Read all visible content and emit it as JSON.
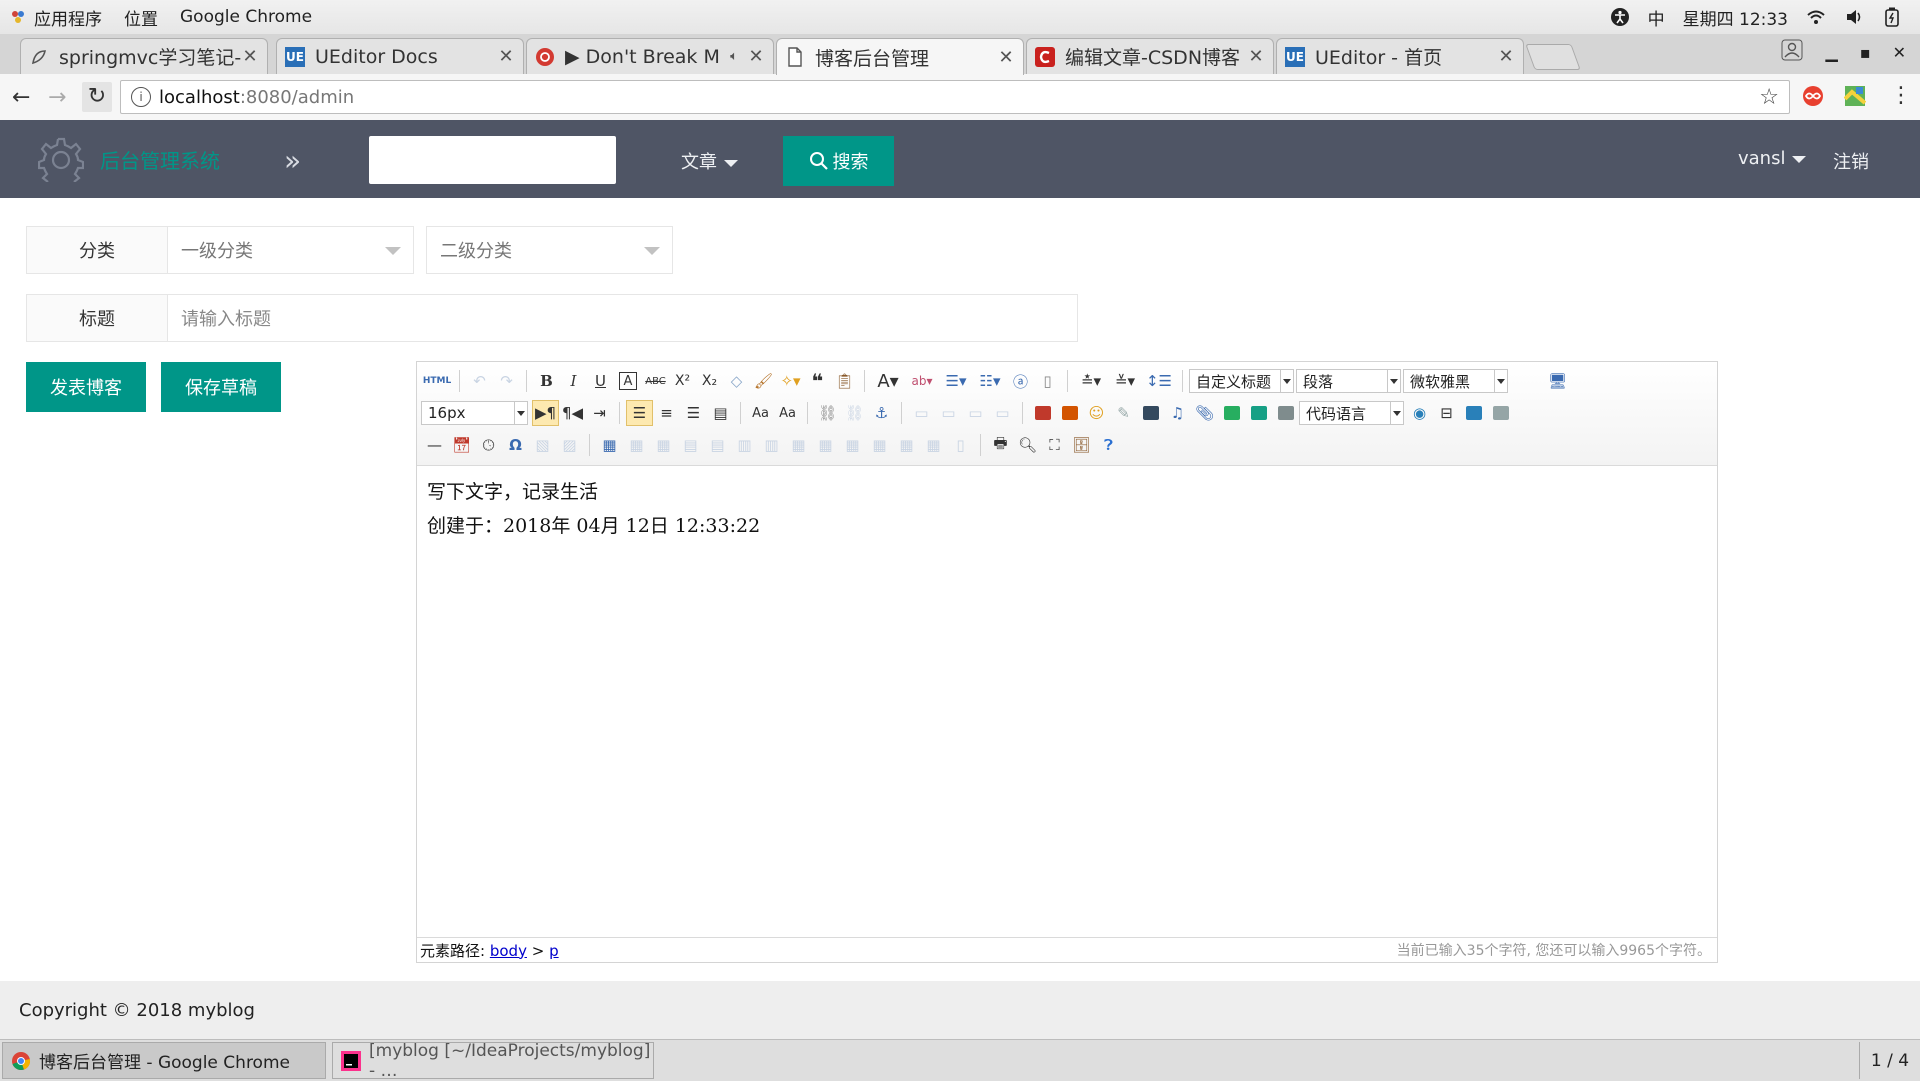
{
  "os": {
    "menu_apps": "应用程序",
    "menu_places": "位置",
    "active_app": "Google Chrome",
    "input_method": "中",
    "clock": "星期四 12:33"
  },
  "tabs": [
    {
      "title": "springmvc学习笔记-",
      "icon": "springmvc-icon",
      "active": false
    },
    {
      "title": "UEditor Docs",
      "icon": "ueditor-icon",
      "active": false
    },
    {
      "title": "▶ Don't Break M",
      "icon": "netease-music-icon",
      "active": false
    },
    {
      "title": "博客后台管理",
      "icon": "page-icon",
      "active": true
    },
    {
      "title": "编辑文章-CSDN博客",
      "icon": "csdn-icon",
      "active": false
    },
    {
      "title": "UEditor - 首页",
      "icon": "ueditor-icon",
      "active": false
    }
  ],
  "address": {
    "host": "localhost",
    "path": ":8080/admin"
  },
  "header": {
    "system_name": "后台管理系统",
    "nav_article": "文章",
    "search_button": "搜索",
    "username": "vansl",
    "logout": "注销"
  },
  "form": {
    "category_label": "分类",
    "category_primary_placeholder": "一级分类",
    "category_secondary_placeholder": "二级分类",
    "title_label": "标题",
    "title_placeholder": "请输入标题",
    "publish_button": "发表博客",
    "draft_button": "保存草稿"
  },
  "editor": {
    "font_size": "16px",
    "custom_heading": "自定义标题",
    "paragraph_format": "段落",
    "font_family": "微软雅黑",
    "code_language": "代码语言",
    "content_line1": "写下文字，记录生活",
    "content_line2": "创建于：2018年 04月 12日 12:33:22",
    "status_path_label": "元素路径:",
    "status_path_body": "body",
    "status_path_sep": ">",
    "status_path_p": "p",
    "char_count": "当前已输入35个字符, 您还可以输入9965个字符。"
  },
  "footer": {
    "copyright": "Copyright © 2018 myblog"
  },
  "taskbar": {
    "items": [
      {
        "title": "博客后台管理 - Google Chrome",
        "active": true
      },
      {
        "title": "[myblog [~/IdeaProjects/myblog] - …",
        "active": false
      }
    ],
    "pager": "1 / 4"
  },
  "colors": {
    "accent": "#009688",
    "header_bg": "#4f5565"
  }
}
